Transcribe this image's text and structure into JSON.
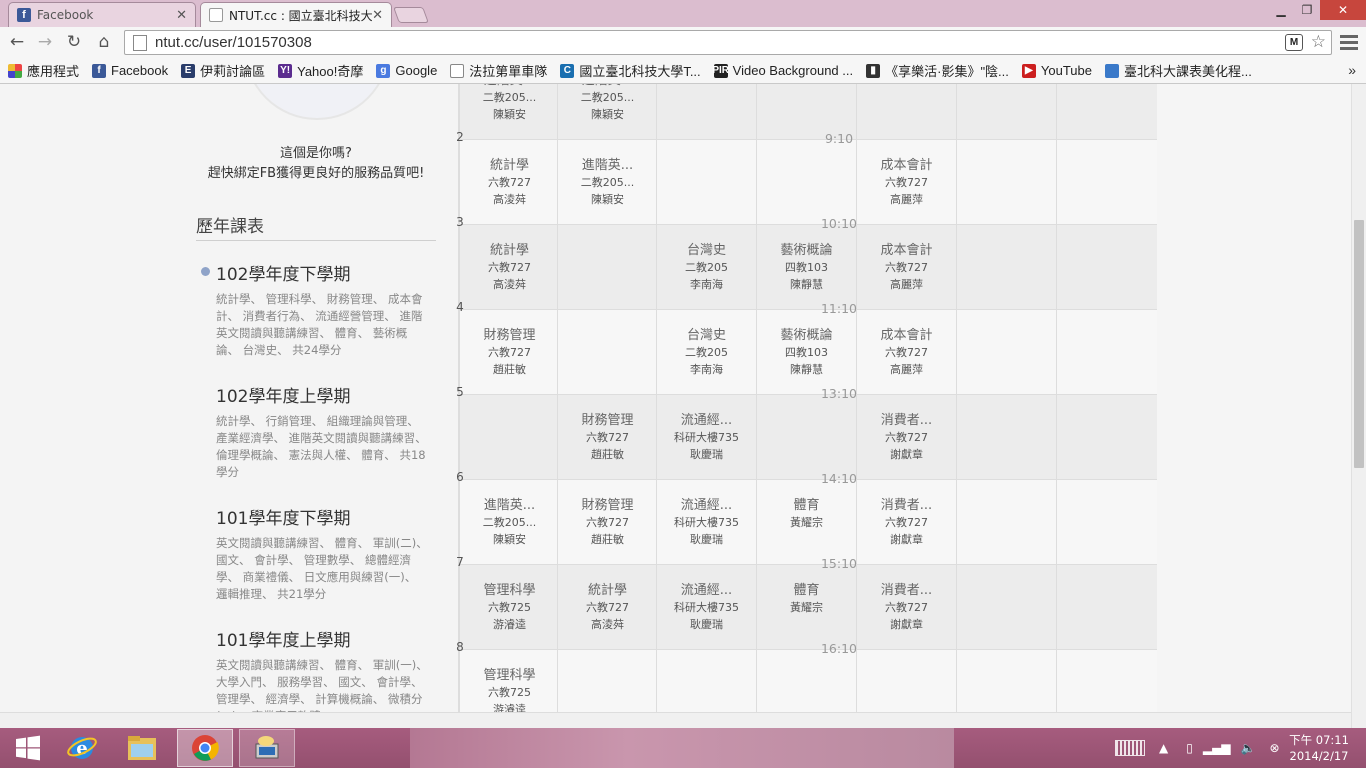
{
  "browser": {
    "tabs": [
      {
        "title": "Facebook",
        "icon": "facebook-icon",
        "active": false
      },
      {
        "title": "NTUT.cc : 國立臺北科技大",
        "icon": "document-icon",
        "active": true
      }
    ],
    "url": "ntut.cc/user/101570308",
    "ext_label": "M",
    "bookmarks": [
      {
        "label": "應用程式",
        "icon": "apps-grid-icon"
      },
      {
        "label": "Facebook",
        "icon": "facebook-icon",
        "ic": "f",
        "color": "#3b5998"
      },
      {
        "label": "伊莉討論區",
        "icon": "eyny-icon",
        "ic": "E",
        "color": "#2a3d6b"
      },
      {
        "label": "Yahoo!奇摩",
        "icon": "yahoo-icon",
        "ic": "Y!",
        "color": "#5b2c8f"
      },
      {
        "label": "Google",
        "icon": "google-icon",
        "ic": "g",
        "color": "#4a7ae0"
      },
      {
        "label": "法拉第單車隊",
        "icon": "page-icon",
        "ic": "",
        "color": "#fff"
      },
      {
        "label": "國立臺北科技大學T...",
        "icon": "ntut-icon",
        "ic": "C",
        "color": "#1a6fb0"
      },
      {
        "label": "Video Background ...",
        "icon": "pir-icon",
        "ic": "PIR",
        "color": "#222"
      },
      {
        "label": "《享樂活·影集》\"陰...",
        "icon": "bookmark-icon",
        "ic": "▮",
        "color": "#333"
      },
      {
        "label": "YouTube",
        "icon": "youtube-icon",
        "ic": "▶",
        "color": "#cc1f1f"
      },
      {
        "label": "臺北科大課表美化程...",
        "icon": "ntut-blue-icon",
        "ic": "",
        "color": "#3a79c9"
      }
    ],
    "more": "»"
  },
  "sidebar": {
    "fb_question": "這個是你嗎?",
    "fb_hint": "趕快綁定FB獲得更良好的服務品質吧!",
    "history_title": "歷年課表",
    "terms": [
      {
        "name": "102學年度下學期",
        "courses": "統計學、 管理科學、 財務管理、 成本會計、 消費者行為、 流通經營管理、 進階英文閱讀與聽講練習、 體育、 藝術概論、 台灣史、 共24學分"
      },
      {
        "name": "102學年度上學期",
        "courses": "統計學、 行銷管理、 組織理論與管理、 產業經濟學、 進階英文閱讀與聽講練習、 倫理學概論、 憲法與人權、 體育、 共18學分"
      },
      {
        "name": "101學年度下學期",
        "courses": "英文閱讀與聽講練習、 體育、 軍訓(二)、 國文、 會計學、 管理數學、 總體經濟學、 商業禮儀、 日文應用與練習(一)、 邏輯推理、 共21學分"
      },
      {
        "name": "101學年度上學期",
        "courses": "英文閱讀與聽講練習、 體育、 軍訓(一)、 大學入門、 服務學習、 國文、 會計學、 管理學、 經濟學、 計算機概論、 微積分(一)、 商業應用軟體"
      }
    ]
  },
  "schedule": {
    "periods": [
      {
        "num": "",
        "time": "",
        "cells": [
          {
            "name": "進階英...",
            "room": "二教205...",
            "teacher": "陳穎安"
          },
          {
            "name": "進階英...",
            "room": "二教205...",
            "teacher": "陳穎安"
          },
          null,
          null,
          null,
          null,
          null
        ]
      },
      {
        "num": "2",
        "time": "9:10",
        "cells": [
          {
            "name": "統計學",
            "room": "六教727",
            "teacher": "高淩荈"
          },
          {
            "name": "進階英...",
            "room": "二教205...",
            "teacher": "陳穎安"
          },
          null,
          null,
          {
            "name": "成本會計",
            "room": "六教727",
            "teacher": "高麗萍"
          },
          null,
          null
        ]
      },
      {
        "num": "3",
        "time": "10:10",
        "cells": [
          {
            "name": "統計學",
            "room": "六教727",
            "teacher": "高淩荈"
          },
          null,
          {
            "name": "台灣史",
            "room": "二教205",
            "teacher": "李南海"
          },
          {
            "name": "藝術概論",
            "room": "四教103",
            "teacher": "陳靜慧"
          },
          {
            "name": "成本會計",
            "room": "六教727",
            "teacher": "高麗萍"
          },
          null,
          null
        ]
      },
      {
        "num": "4",
        "time": "11:10",
        "cells": [
          {
            "name": "財務管理",
            "room": "六教727",
            "teacher": "趙莊敏"
          },
          null,
          {
            "name": "台灣史",
            "room": "二教205",
            "teacher": "李南海"
          },
          {
            "name": "藝術概論",
            "room": "四教103",
            "teacher": "陳靜慧"
          },
          {
            "name": "成本會計",
            "room": "六教727",
            "teacher": "高麗萍"
          },
          null,
          null
        ]
      },
      {
        "num": "5",
        "time": "13:10",
        "cells": [
          null,
          {
            "name": "財務管理",
            "room": "六教727",
            "teacher": "趙莊敏"
          },
          {
            "name": "流通經...",
            "room": "科研大樓735",
            "teacher": "耿慶瑞"
          },
          null,
          {
            "name": "消費者...",
            "room": "六教727",
            "teacher": "謝獻章"
          },
          null,
          null
        ]
      },
      {
        "num": "6",
        "time": "14:10",
        "cells": [
          {
            "name": "進階英...",
            "room": "二教205...",
            "teacher": "陳穎安"
          },
          {
            "name": "財務管理",
            "room": "六教727",
            "teacher": "趙莊敏"
          },
          {
            "name": "流通經...",
            "room": "科研大樓735",
            "teacher": "耿慶瑞"
          },
          {
            "name": "體育",
            "room": "黃耀宗",
            "teacher": ""
          },
          {
            "name": "消費者...",
            "room": "六教727",
            "teacher": "謝獻章"
          },
          null,
          null
        ]
      },
      {
        "num": "7",
        "time": "15:10",
        "cells": [
          {
            "name": "管理科學",
            "room": "六教725",
            "teacher": "游濬逵"
          },
          {
            "name": "統計學",
            "room": "六教727",
            "teacher": "高淩荈"
          },
          {
            "name": "流通經...",
            "room": "科研大樓735",
            "teacher": "耿慶瑞"
          },
          {
            "name": "體育",
            "room": "黃耀宗",
            "teacher": ""
          },
          {
            "name": "消費者...",
            "room": "六教727",
            "teacher": "謝獻章"
          },
          null,
          null
        ]
      },
      {
        "num": "8",
        "time": "16:10",
        "cells": [
          {
            "name": "管理科學",
            "room": "六教725",
            "teacher": "游濬逵"
          },
          null,
          null,
          null,
          null,
          null,
          null
        ]
      }
    ]
  },
  "taskbar": {
    "apps": [
      "windows-start-icon",
      "ie-icon",
      "file-explorer-icon",
      "chrome-icon",
      "network-app-icon"
    ],
    "clock_time": "下午 07:11",
    "clock_date": "2014/2/17"
  }
}
